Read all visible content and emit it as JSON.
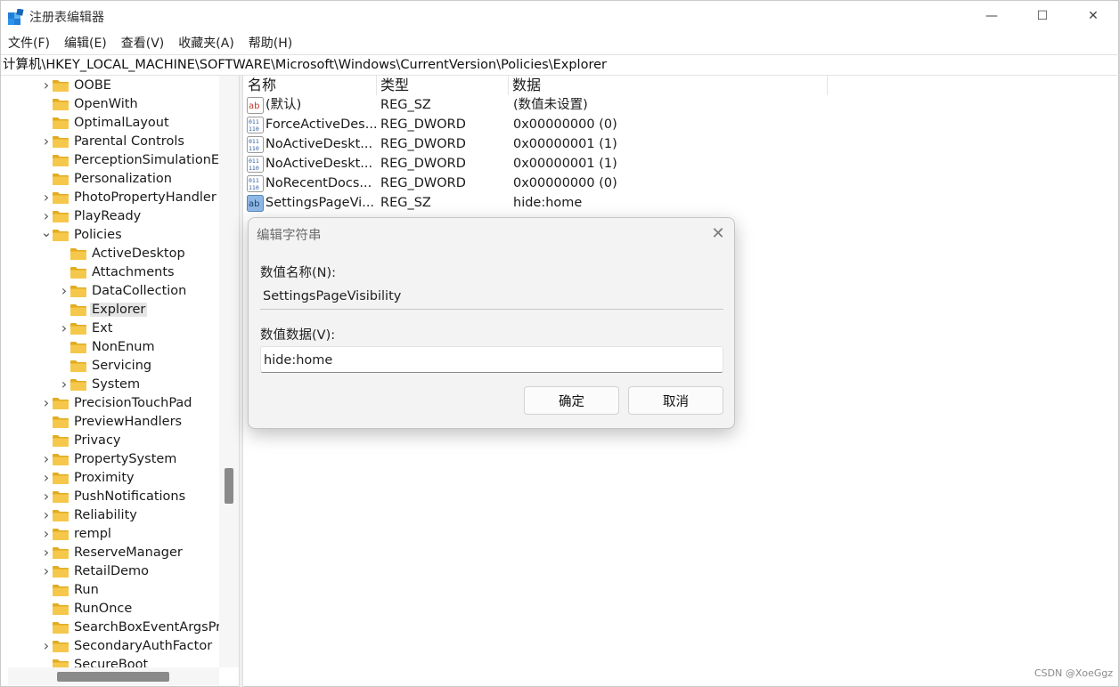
{
  "window": {
    "title": "注册表编辑器",
    "minimize_glyph": "—",
    "maximize_glyph": "☐",
    "close_glyph": "✕"
  },
  "menu": [
    "文件(F)",
    "编辑(E)",
    "查看(V)",
    "收藏夹(A)",
    "帮助(H)"
  ],
  "address": "计算机\\HKEY_LOCAL_MACHINE\\SOFTWARE\\Microsoft\\Windows\\CurrentVersion\\Policies\\Explorer",
  "tree": [
    {
      "label": "OOBE",
      "level": 0,
      "expander": "collapsed"
    },
    {
      "label": "OpenWith",
      "level": 0,
      "expander": "none"
    },
    {
      "label": "OptimalLayout",
      "level": 0,
      "expander": "none"
    },
    {
      "label": "Parental Controls",
      "level": 0,
      "expander": "collapsed"
    },
    {
      "label": "PerceptionSimulationE",
      "level": 0,
      "expander": "none"
    },
    {
      "label": "Personalization",
      "level": 0,
      "expander": "none"
    },
    {
      "label": "PhotoPropertyHandler",
      "level": 0,
      "expander": "collapsed"
    },
    {
      "label": "PlayReady",
      "level": 0,
      "expander": "collapsed"
    },
    {
      "label": "Policies",
      "level": 0,
      "expander": "expanded"
    },
    {
      "label": "ActiveDesktop",
      "level": 1,
      "expander": "none"
    },
    {
      "label": "Attachments",
      "level": 1,
      "expander": "none"
    },
    {
      "label": "DataCollection",
      "level": 1,
      "expander": "collapsed"
    },
    {
      "label": "Explorer",
      "level": 1,
      "expander": "none",
      "selected": true
    },
    {
      "label": "Ext",
      "level": 1,
      "expander": "collapsed"
    },
    {
      "label": "NonEnum",
      "level": 1,
      "expander": "none"
    },
    {
      "label": "Servicing",
      "level": 1,
      "expander": "none"
    },
    {
      "label": "System",
      "level": 1,
      "expander": "collapsed"
    },
    {
      "label": "PrecisionTouchPad",
      "level": 0,
      "expander": "collapsed"
    },
    {
      "label": "PreviewHandlers",
      "level": 0,
      "expander": "none"
    },
    {
      "label": "Privacy",
      "level": 0,
      "expander": "none"
    },
    {
      "label": "PropertySystem",
      "level": 0,
      "expander": "collapsed"
    },
    {
      "label": "Proximity",
      "level": 0,
      "expander": "collapsed"
    },
    {
      "label": "PushNotifications",
      "level": 0,
      "expander": "collapsed"
    },
    {
      "label": "Reliability",
      "level": 0,
      "expander": "collapsed"
    },
    {
      "label": "rempl",
      "level": 0,
      "expander": "collapsed"
    },
    {
      "label": "ReserveManager",
      "level": 0,
      "expander": "collapsed"
    },
    {
      "label": "RetailDemo",
      "level": 0,
      "expander": "collapsed"
    },
    {
      "label": "Run",
      "level": 0,
      "expander": "none"
    },
    {
      "label": "RunOnce",
      "level": 0,
      "expander": "none"
    },
    {
      "label": "SearchBoxEventArgsPr",
      "level": 0,
      "expander": "none"
    },
    {
      "label": "SecondaryAuthFactor",
      "level": 0,
      "expander": "collapsed"
    },
    {
      "label": "SecureBoot",
      "level": 0,
      "expander": "none"
    }
  ],
  "columns": {
    "name": "名称",
    "type": "类型",
    "data": "数据"
  },
  "values": [
    {
      "icon": "string-value-icon",
      "name": "(默认)",
      "type": "REG_SZ",
      "data": "(数值未设置)"
    },
    {
      "icon": "binary-value-icon",
      "name": "ForceActiveDes...",
      "type": "REG_DWORD",
      "data": "0x00000000 (0)"
    },
    {
      "icon": "binary-value-icon",
      "name": "NoActiveDeskt...",
      "type": "REG_DWORD",
      "data": "0x00000001 (1)"
    },
    {
      "icon": "binary-value-icon",
      "name": "NoActiveDeskt...",
      "type": "REG_DWORD",
      "data": "0x00000001 (1)"
    },
    {
      "icon": "binary-value-icon",
      "name": "NoRecentDocs...",
      "type": "REG_DWORD",
      "data": "0x00000000 (0)"
    },
    {
      "icon": "string-value-icon",
      "name": "SettingsPageVi...",
      "type": "REG_SZ",
      "data": "hide:home"
    }
  ],
  "dialog": {
    "title": "编辑字符串",
    "name_label": "数值名称(N):",
    "name_value": "SettingsPageVisibility",
    "data_label": "数值数据(V):",
    "data_value": "hide:home",
    "ok": "确定",
    "cancel": "取消",
    "close_glyph": "✕"
  },
  "watermark": "CSDN @XoeGgz",
  "colors": {
    "folder": "#f5c84c",
    "folder_dark": "#e2ac21",
    "selection": "#e5e5e5",
    "accent": "#2b7cd3"
  }
}
